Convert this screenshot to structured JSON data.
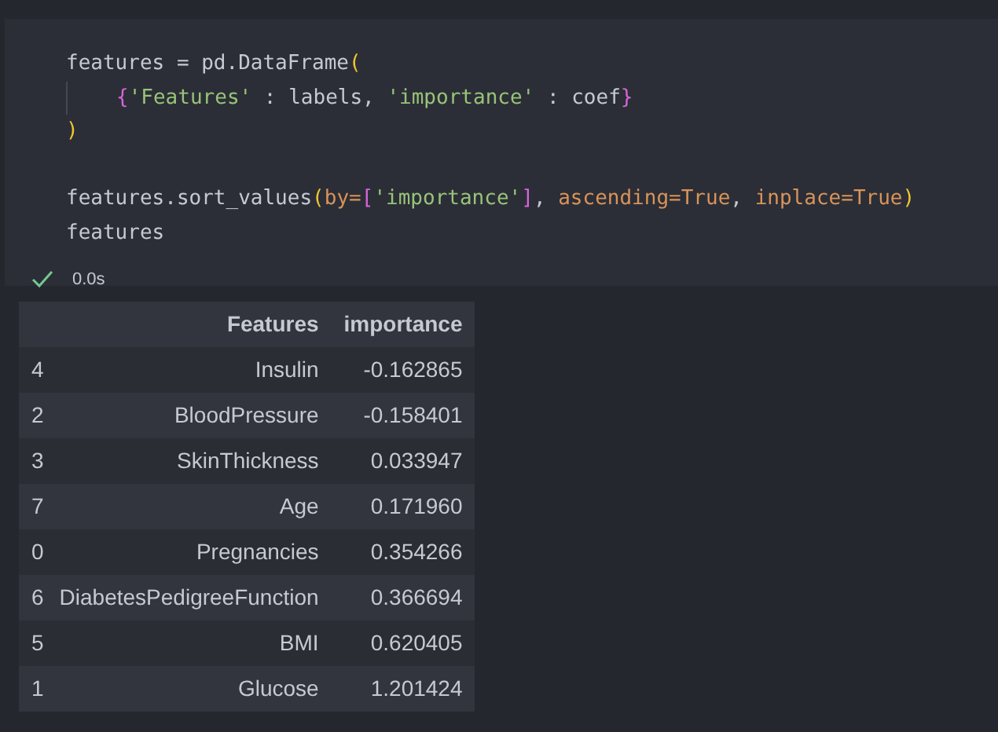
{
  "cell": {
    "code_lines": [
      {
        "indent": false,
        "blank_before": false,
        "tokens": [
          {
            "kind": "plain",
            "text": "features = pd.DataFrame"
          },
          {
            "kind": "paren",
            "text": "("
          }
        ]
      },
      {
        "indent": true,
        "blank_before": false,
        "tokens": [
          {
            "kind": "brace",
            "text": "{"
          },
          {
            "kind": "string",
            "text": "'Features'"
          },
          {
            "kind": "plain",
            "text": " : labels, "
          },
          {
            "kind": "string",
            "text": "'importance'"
          },
          {
            "kind": "plain",
            "text": " : coef"
          },
          {
            "kind": "brace",
            "text": "}"
          }
        ]
      },
      {
        "indent": false,
        "blank_before": false,
        "tokens": [
          {
            "kind": "paren",
            "text": ")"
          }
        ]
      },
      {
        "indent": false,
        "blank_before": true,
        "tokens": [
          {
            "kind": "plain",
            "text": "features.sort_values"
          },
          {
            "kind": "paren",
            "text": "("
          },
          {
            "kind": "param",
            "text": "by="
          },
          {
            "kind": "brace",
            "text": "["
          },
          {
            "kind": "string",
            "text": "'importance'"
          },
          {
            "kind": "brace",
            "text": "]"
          },
          {
            "kind": "plain",
            "text": ", "
          },
          {
            "kind": "param",
            "text": "ascending=True"
          },
          {
            "kind": "plain",
            "text": ", "
          },
          {
            "kind": "param",
            "text": "inplace=True"
          },
          {
            "kind": "paren",
            "text": ")"
          }
        ]
      },
      {
        "indent": false,
        "blank_before": false,
        "tokens": [
          {
            "kind": "plain",
            "text": "features"
          }
        ]
      }
    ],
    "status": {
      "succeeded": true,
      "duration": "0.0s"
    }
  },
  "output": {
    "table": {
      "columns": [
        "Features",
        "importance"
      ],
      "rows": [
        {
          "index": "4",
          "cells": [
            "Insulin",
            "-0.162865"
          ]
        },
        {
          "index": "2",
          "cells": [
            "BloodPressure",
            "-0.158401"
          ]
        },
        {
          "index": "3",
          "cells": [
            "SkinThickness",
            "0.033947"
          ]
        },
        {
          "index": "7",
          "cells": [
            "Age",
            "0.171960"
          ]
        },
        {
          "index": "0",
          "cells": [
            "Pregnancies",
            "0.354266"
          ]
        },
        {
          "index": "6",
          "cells": [
            "DiabetesPedigreeFunction",
            "0.366694"
          ]
        },
        {
          "index": "5",
          "cells": [
            "BMI",
            "0.620405"
          ]
        },
        {
          "index": "1",
          "cells": [
            "Glucose",
            "1.201424"
          ]
        }
      ]
    }
  }
}
